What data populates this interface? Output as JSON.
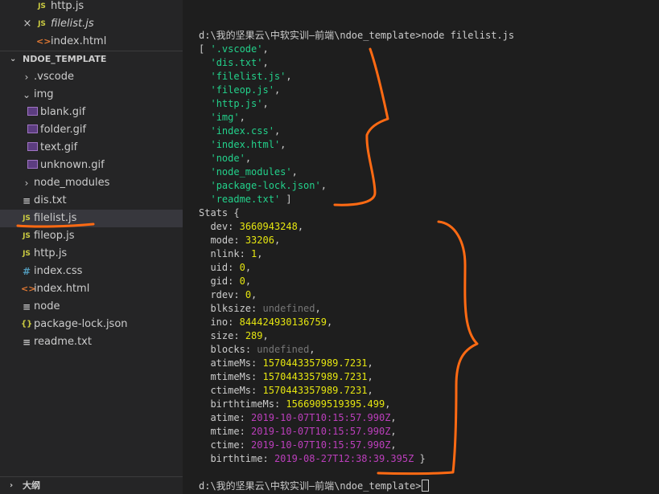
{
  "explorer": {
    "open_editors": [
      {
        "label": "http.js",
        "type": "js"
      },
      {
        "label": "filelist.js",
        "type": "js",
        "italic": true,
        "close": "×"
      },
      {
        "label": "index.html",
        "type": "html"
      }
    ],
    "workspace_title": "NDOE_TEMPLATE",
    "tree": [
      {
        "label": ".vscode",
        "type": "folder-closed"
      },
      {
        "label": "img",
        "type": "folder-open"
      },
      {
        "label": "blank.gif",
        "type": "gif"
      },
      {
        "label": "folder.gif",
        "type": "gif"
      },
      {
        "label": "text.gif",
        "type": "gif"
      },
      {
        "label": "unknown.gif",
        "type": "gif"
      },
      {
        "label": "node_modules",
        "type": "folder-closed"
      },
      {
        "label": "dis.txt",
        "type": "txt"
      },
      {
        "label": "filelist.js",
        "type": "js",
        "selected": true
      },
      {
        "label": "fileop.js",
        "type": "js"
      },
      {
        "label": "http.js",
        "type": "js"
      },
      {
        "label": "index.css",
        "type": "css"
      },
      {
        "label": "index.html",
        "type": "html"
      },
      {
        "label": "node",
        "type": "txt"
      },
      {
        "label": "package-lock.json",
        "type": "json"
      },
      {
        "label": "readme.txt",
        "type": "txt"
      }
    ],
    "outline_title": "大纲"
  },
  "icons": {
    "js": "JS",
    "html": "<>",
    "css": "#",
    "json": "{}",
    "txt": "≡",
    "folder-closed": "›",
    "folder-open": "⌄",
    "section": "›"
  },
  "colors": {
    "string": "#23d18b",
    "number": "#e5e510",
    "undefined": "#767676",
    "date": "#bc3fbc",
    "annotation": "#ff6a13"
  },
  "terminal": {
    "command_line": "d:\\我的坚果云\\中软实训—前端\\ndoe_template>node filelist.js",
    "files_open": "[ ",
    "files": [
      ".vscode",
      "dis.txt",
      "filelist.js",
      "fileop.js",
      "http.js",
      "img",
      "index.css",
      "index.html",
      "node",
      "node_modules",
      "package-lock.json",
      "readme.txt"
    ],
    "files_close": " ]",
    "stats_open": "Stats {",
    "stats": [
      {
        "key": "dev",
        "value": "3660943248",
        "kind": "number"
      },
      {
        "key": "mode",
        "value": "33206",
        "kind": "number"
      },
      {
        "key": "nlink",
        "value": "1",
        "kind": "number"
      },
      {
        "key": "uid",
        "value": "0",
        "kind": "number"
      },
      {
        "key": "gid",
        "value": "0",
        "kind": "number"
      },
      {
        "key": "rdev",
        "value": "0",
        "kind": "number"
      },
      {
        "key": "blksize",
        "value": "undefined",
        "kind": "undefined"
      },
      {
        "key": "ino",
        "value": "844424930136759",
        "kind": "number"
      },
      {
        "key": "size",
        "value": "289",
        "kind": "number"
      },
      {
        "key": "blocks",
        "value": "undefined",
        "kind": "undefined"
      },
      {
        "key": "atimeMs",
        "value": "1570443357989.7231",
        "kind": "number"
      },
      {
        "key": "mtimeMs",
        "value": "1570443357989.7231",
        "kind": "number"
      },
      {
        "key": "ctimeMs",
        "value": "1570443357989.7231",
        "kind": "number"
      },
      {
        "key": "birthtimeMs",
        "value": "1566909519395.499",
        "kind": "number"
      },
      {
        "key": "atime",
        "value": "2019-10-07T10:15:57.990Z",
        "kind": "date"
      },
      {
        "key": "mtime",
        "value": "2019-10-07T10:15:57.990Z",
        "kind": "date"
      },
      {
        "key": "ctime",
        "value": "2019-10-07T10:15:57.990Z",
        "kind": "date"
      },
      {
        "key": "birthtime",
        "value": "2019-08-27T12:38:39.395Z",
        "kind": "date"
      }
    ],
    "stats_close": " }",
    "prompt": "d:\\我的坚果云\\中软实训—前端\\ndoe_template>"
  }
}
